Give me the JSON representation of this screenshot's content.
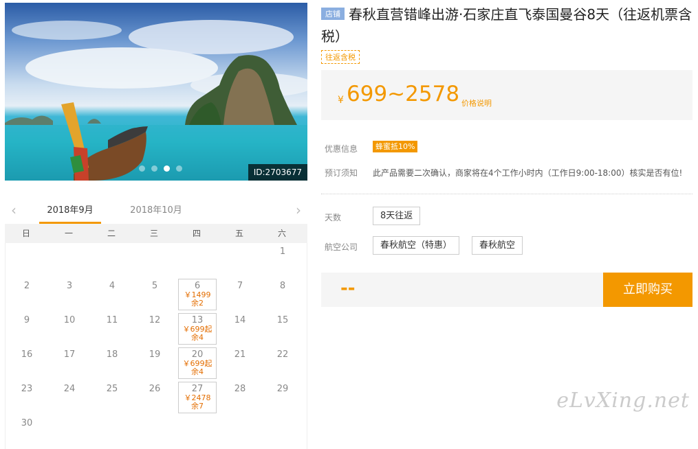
{
  "hero": {
    "id_label": "ID:2703677",
    "dots": 4,
    "active_dot": 2
  },
  "calendar": {
    "months": [
      "2018年9月",
      "2018年10月"
    ],
    "active_month": 0,
    "weekdays": [
      "日",
      "一",
      "二",
      "三",
      "四",
      "五",
      "六"
    ],
    "cells": [
      {
        "day": ""
      },
      {
        "day": ""
      },
      {
        "day": ""
      },
      {
        "day": ""
      },
      {
        "day": ""
      },
      {
        "day": ""
      },
      {
        "day": "1"
      },
      {
        "day": "2"
      },
      {
        "day": "3"
      },
      {
        "day": "4"
      },
      {
        "day": "5"
      },
      {
        "day": "6",
        "price": "￥1499",
        "stock": "余2"
      },
      {
        "day": "7"
      },
      {
        "day": "8"
      },
      {
        "day": "9"
      },
      {
        "day": "10"
      },
      {
        "day": "11"
      },
      {
        "day": "12"
      },
      {
        "day": "13",
        "price": "￥699起",
        "stock": "余4"
      },
      {
        "day": "14"
      },
      {
        "day": "15"
      },
      {
        "day": "16"
      },
      {
        "day": "17"
      },
      {
        "day": "18"
      },
      {
        "day": "19"
      },
      {
        "day": "20",
        "price": "￥699起",
        "stock": "余4"
      },
      {
        "day": "21"
      },
      {
        "day": "22"
      },
      {
        "day": "23"
      },
      {
        "day": "24"
      },
      {
        "day": "25"
      },
      {
        "day": "26"
      },
      {
        "day": "27",
        "price": "￥2478",
        "stock": "余7"
      },
      {
        "day": "28"
      },
      {
        "day": "29"
      },
      {
        "day": "30"
      }
    ]
  },
  "product": {
    "shop_badge": "店铺",
    "title": "春秋直营错峰出游·石家庄直飞泰国曼谷8天（往返机票含税）",
    "tax_tag": "往返含税",
    "currency": "¥",
    "price_range": "699~2578",
    "price_note": "价格说明"
  },
  "info": {
    "promo_label": "优惠信息",
    "promo_badge": "蜂蜜抵10%",
    "notice_label": "预订须知",
    "notice_text": "此产品需要二次确认，商家将在4个工作小时内（工作日9:00-18:00）核实是否有位!"
  },
  "options": {
    "days_label": "天数",
    "days_value": "8天往返",
    "airline_label": "航空公司",
    "airlines": [
      "春秋航空（特惠）",
      "春秋航空"
    ]
  },
  "buy": {
    "total": "--",
    "button": "立即购买"
  },
  "watermark": "eLvXing.net",
  "colors": {
    "accent": "#f39800",
    "badge_blue": "#8aaee0"
  }
}
